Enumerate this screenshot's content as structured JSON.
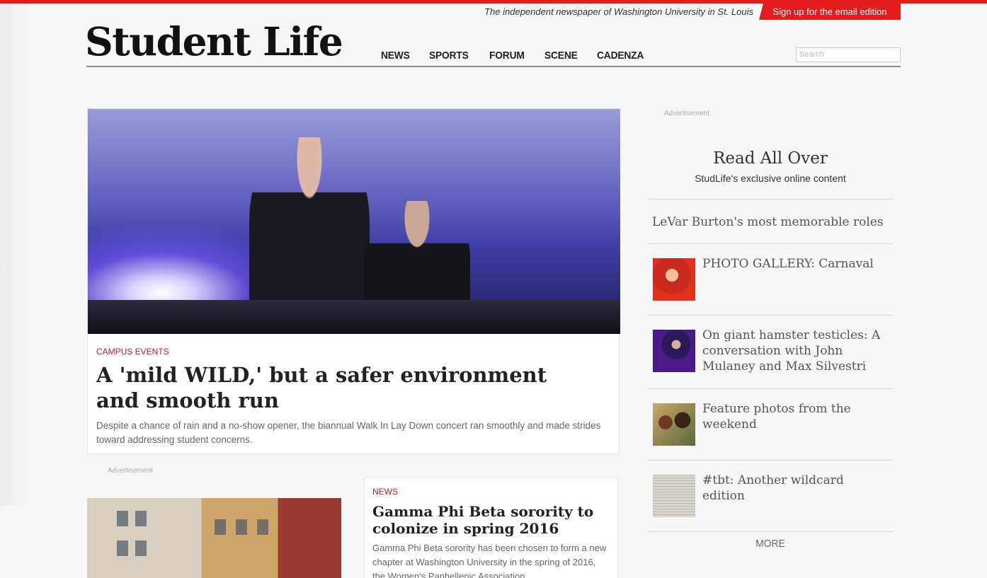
{
  "header": {
    "tagline": "The independent newspaper of Washington University in St. Louis",
    "signup_label": "Sign up for the email edition",
    "logo": "Student Life",
    "nav": [
      "NEWS",
      "SPORTS",
      "FORUM",
      "SCENE",
      "CADENZA"
    ],
    "search_placeholder": "Search"
  },
  "colors": {
    "brand_red": "#e31c1c",
    "kicker_red": "#d0161e"
  },
  "feature": {
    "kicker": "CAMPUS EVENTS",
    "title": "A 'mild WILD,' but a safer environment and smooth run",
    "description": "Despite a chance of rain and a no-show opener, the biannual Walk In Lay Down concert ran smoothly and made strides toward addressing student concerns."
  },
  "ads": {
    "label_main": "Advertisement",
    "label_side": "Advertisement"
  },
  "second_story": {
    "kicker": "NEWS",
    "title": "Gamma Phi Beta sorority to colonize in spring 2016",
    "description": "Gamma Phi Beta sorority has been chosen to form a new chapter at Washington University in the spring of 2016, the Women's Panhellenic Association"
  },
  "sidebar": {
    "title": "Read All Over",
    "subtitle": "StudLife's exclusive online content",
    "items": [
      {
        "text": "LeVar Burton's most memorable roles",
        "thumb": "none"
      },
      {
        "text": "PHOTO GALLERY: Carnaval",
        "thumb": "dancer-photo"
      },
      {
        "text": "On giant hamster testicles: A conversation with John Mulaney and Max Silvestri",
        "thumb": "comedian-photo"
      },
      {
        "text": "Feature photos from the weekend",
        "thumb": "students-photo"
      },
      {
        "text": "#tbt: Another wildcard edition",
        "thumb": "newspaper-photo"
      }
    ],
    "more_label": "MORE"
  }
}
